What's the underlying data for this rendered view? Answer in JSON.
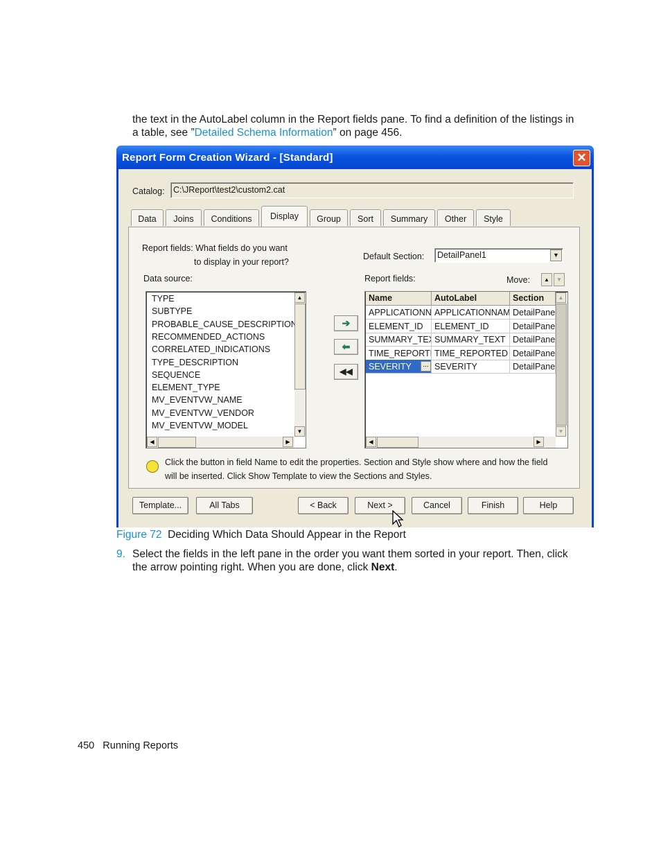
{
  "intro": {
    "text_before": "the text in the AutoLabel column in the Report fields pane. To find a definition of the listings in a table, see ”",
    "link": "Detailed Schema Information",
    "text_after": "” on page 456."
  },
  "dialog": {
    "title": "Report Form Creation Wizard - [Standard]",
    "close_glyph": "✕",
    "catalog_label": "Catalog:",
    "catalog_value": "C:\\JReport\\test2\\custom2.cat",
    "tabs": [
      "Data",
      "Joins",
      "Conditions",
      "Display",
      "Group",
      "Sort",
      "Summary",
      "Other",
      "Style"
    ],
    "instruction_line1": "Report fields:  What fields do you want",
    "instruction_line2": "to display in your report?",
    "default_section_label": "Default Section:",
    "default_section_value": "DetailPanel1",
    "data_source_label": "Data source:",
    "data_source_items": [
      "TYPE",
      "SUBTYPE",
      "PROBABLE_CAUSE_DESCRIPTION",
      "RECOMMENDED_ACTIONS",
      "CORRELATED_INDICATIONS",
      "TYPE_DESCRIPTION",
      "SEQUENCE",
      "ELEMENT_TYPE",
      "MV_EVENTVW_NAME",
      "MV_EVENTVW_VENDOR",
      "MV_EVENTVW_MODEL"
    ],
    "report_fields_label": "Report fields:",
    "move_label": "Move:",
    "grid_headers": [
      "Name",
      "AutoLabel",
      "Section"
    ],
    "grid_rows": [
      [
        "APPLICATIONN.",
        "APPLICATIONNAM",
        "DetailPane"
      ],
      [
        "ELEMENT_ID",
        "ELEMENT_ID",
        "DetailPane"
      ],
      [
        "SUMMARY_TEX",
        "SUMMARY_TEXT",
        "DetailPane"
      ],
      [
        "TIME_REPORTE",
        "TIME_REPORTED",
        "DetailPane"
      ],
      [
        "SEVERITY",
        "SEVERITY",
        "DetailPane"
      ]
    ],
    "ellipsis": "...",
    "hint_line1": "Click the button in field Name to edit the properties. Section and Style show where and how the field",
    "hint_line2": "will be inserted.  Click Show Template to view the Sections and Styles.",
    "buttons": {
      "template": "Template...",
      "all_tabs": "All Tabs",
      "back": "< Back",
      "next": "Next >",
      "cancel": "Cancel",
      "finish": "Finish",
      "help": "Help"
    }
  },
  "caption": {
    "figure": "Figure 72",
    "text": "Deciding Which Data Should Appear in the Report"
  },
  "step": {
    "number": "9.",
    "text_before": "Select the fields in the left pane in the order you want them sorted in your report. Then, click the arrow pointing right. When you are done, click ",
    "bold": "Next",
    "text_after": "."
  },
  "footer": {
    "page": "450",
    "section": "Running Reports"
  }
}
